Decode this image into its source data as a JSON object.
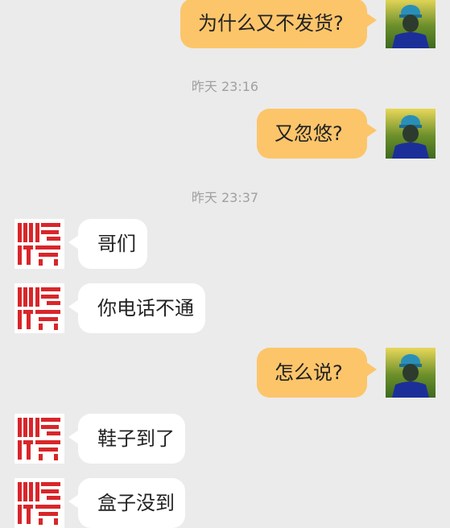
{
  "conversation": {
    "messages": [
      {
        "side": "out",
        "text": "为什么又不发货?"
      },
      {
        "side": "out",
        "text": "又忽悠?"
      },
      {
        "side": "in",
        "text": "哥们"
      },
      {
        "side": "in",
        "text": "你电话不通"
      },
      {
        "side": "out",
        "text": "怎么说?"
      },
      {
        "side": "in",
        "text": "鞋子到了"
      },
      {
        "side": "in",
        "text": "盒子没到"
      }
    ],
    "timestamps": [
      "昨天 23:16",
      "昨天 23:37"
    ]
  },
  "contact": {
    "brand_logo_text": "小鸿体育",
    "brand_color": "#d8262a"
  },
  "colors": {
    "background": "#ebebeb",
    "outgoing_bubble": "#fcc56a",
    "incoming_bubble": "#ffffff",
    "timestamp_text": "#a0a0a0"
  },
  "icons": {
    "user_avatar": "user-avatar-icon",
    "brand_avatar": "brand-logo-icon"
  }
}
